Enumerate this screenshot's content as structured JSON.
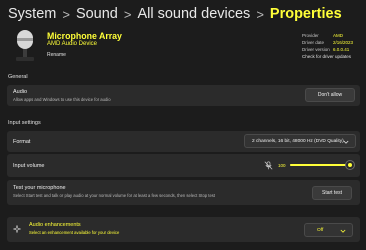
{
  "breadcrumb": {
    "items": [
      "System",
      "Sound",
      "All sound devices"
    ],
    "current": "Properties",
    "separator": ">"
  },
  "device": {
    "icon": "microphone-icon",
    "name": "Microphone Array",
    "subtitle": "AMD Audio Device",
    "rename_label": "Rename"
  },
  "driver_info": {
    "provider_label": "Provider",
    "provider_value": "AMD",
    "date_label": "Driver date",
    "date_value": "2/16/2023",
    "version_label": "Driver version",
    "version_value": "6.0.0.41",
    "check_updates_label": "Check for driver updates"
  },
  "general": {
    "header": "General",
    "audio_title": "Audio",
    "audio_desc": "Allow apps and Windows to use this device for audio",
    "audio_button": "Don't allow"
  },
  "input_settings": {
    "header": "Input settings",
    "format_title": "Format",
    "format_value": "2 channels, 16 bit, 48000 Hz (DVD Quality)",
    "volume_title": "Input volume",
    "volume_value": "100",
    "volume_level": 1.0,
    "test_title": "Test your microphone",
    "test_desc": "Select Start test and talk or play audio at your normal volume for at least a few seconds, then select Stop test",
    "test_button": "Start test"
  },
  "enhancements": {
    "title": "Audio enhancements",
    "desc": "Select an enhancement available for your device",
    "value": "Off"
  },
  "colors": {
    "background": "#1c1c1c",
    "card": "#2b2b2b",
    "accent": "#ffff38"
  }
}
